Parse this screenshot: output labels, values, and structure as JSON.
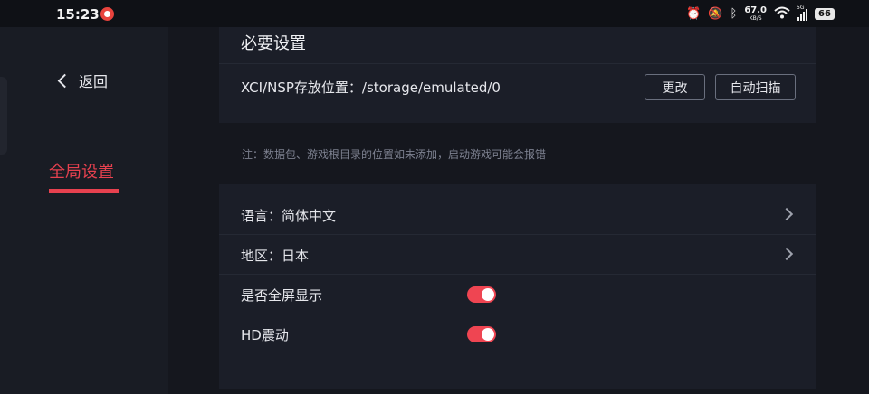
{
  "status_bar": {
    "time": "15:23",
    "net_speed": "67.0",
    "net_unit": "KB/S",
    "signal_label": "5G",
    "battery": "66",
    "icons": [
      "alarm-icon",
      "mute-icon",
      "bluetooth-icon",
      "wifi-icon",
      "signal-icon",
      "battery-icon"
    ]
  },
  "sidebar": {
    "back_label": "返回",
    "items": [
      {
        "label": "全局设置",
        "active": true
      }
    ]
  },
  "essential": {
    "title": "必要设置",
    "path_label": "XCI/NSP存放位置：/storage/emulated/0",
    "change_button": "更改",
    "scan_button": "自动扫描"
  },
  "note": "注：数据包、游戏根目录的位置如未添加，启动游戏可能会报错",
  "settings": {
    "language": "语言：简体中文",
    "region": "地区：日本",
    "fullscreen": {
      "label": "是否全屏显示",
      "on": true
    },
    "hd_rumble": {
      "label": "HD震动",
      "on": true
    }
  },
  "colors": {
    "accent": "#e7414f",
    "background": "#14161d",
    "card": "#1b1e28"
  }
}
